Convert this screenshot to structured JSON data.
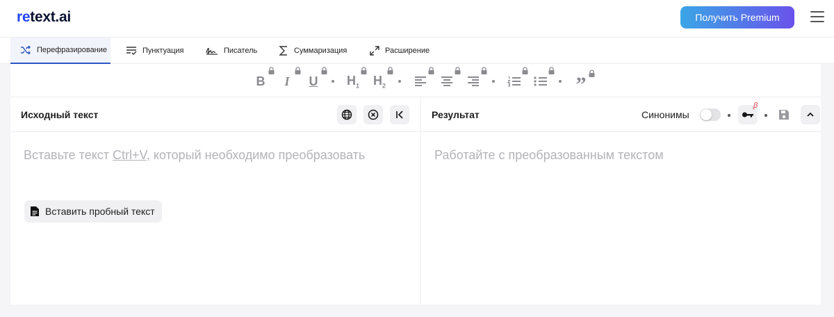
{
  "header": {
    "logo_prefix": "re",
    "logo_rest": "text.ai",
    "premium_label": "Получить Premium",
    "accent_from": "#3aa5e6",
    "accent_to": "#6a52eb"
  },
  "tabs": [
    {
      "label": "Перефразирование",
      "icon": "shuffle-icon",
      "active": true
    },
    {
      "label": "Пунктуация",
      "icon": "punctuation-check-icon",
      "active": false
    },
    {
      "label": "Писатель",
      "icon": "signature-icon",
      "active": false
    },
    {
      "label": "Суммаризация",
      "icon": "sigma-icon",
      "active": false
    },
    {
      "label": "Расширение",
      "icon": "expand-arrows-icon",
      "active": false
    }
  ],
  "toolbar": {
    "bold": "B",
    "italic": "I",
    "underline": "U",
    "heading": "H",
    "h1_sub": "1",
    "h2_sub": "2",
    "quote": "”"
  },
  "source_panel": {
    "title": "Исходный текст",
    "placeholder_before": "Вставьте текст ",
    "placeholder_kbd": "Ctrl+V",
    "placeholder_after": ", который необходимо преобразовать",
    "sample_button": "Вставить пробный текст"
  },
  "result_panel": {
    "title": "Результат",
    "placeholder": "Работайте с преобразованным текстом",
    "synonyms_label": "Синонимы",
    "synonyms_enabled": false,
    "beta_badge": "β"
  }
}
